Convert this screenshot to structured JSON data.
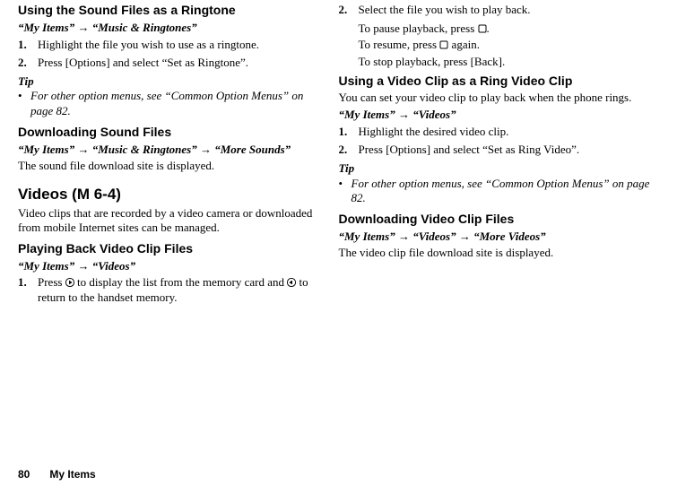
{
  "left": {
    "h1": "Using the Sound Files as a Ringtone",
    "path1_a": "“My Items”",
    "arrow": "→",
    "path1_b": "“Music & Ringtones”",
    "step1_marker": "1.",
    "step1_text": "Highlight the file you wish to use as a ringtone.",
    "step2_marker": "2.",
    "step2_text": "Press [Options] and select “Set as Ringtone”.",
    "tip_label": "Tip",
    "tip_bullet": "•",
    "tip_text": "For other option menus, see “Common Option Menus” on page 82.",
    "h2": "Downloading Sound Files",
    "path2_a": "“My Items”",
    "path2_b": "“Music & Ringtones”",
    "path2_c": "“More Sounds”",
    "dl_text": "The sound file download site is displayed.",
    "h_major": "Videos (M 6-4)",
    "videos_intro": "Video clips that are recorded by a video camera or downloaded from mobile Internet sites can be managed.",
    "h3": "Playing Back Video Clip Files",
    "path3_a": "“My Items”",
    "path3_b": "“Videos”",
    "play_step1_marker": "1.",
    "play_step1_a": "Press ",
    "play_step1_b": " to display the list from the memory card and ",
    "play_step1_c": " to return to the handset memory."
  },
  "right": {
    "step2_marker": "2.",
    "step2_text": "Select the file you wish to play back.",
    "pause_a": "To pause playback, press ",
    "pause_b": ".",
    "resume_a": "To resume, press ",
    "resume_b": " again.",
    "stop_text": "To stop playback, press [Back].",
    "h1": "Using a Video Clip as a Ring Video Clip",
    "intro": "You can set your video clip to play back when the phone rings.",
    "path1_a": "“My Items”",
    "arrow": "→",
    "path1_b": "“Videos”",
    "rstep1_marker": "1.",
    "rstep1_text": "Highlight the desired video clip.",
    "rstep2_marker": "2.",
    "rstep2_text": "Press [Options] and select “Set as Ring Video”.",
    "tip_label": "Tip",
    "tip_bullet": "•",
    "tip_text": "For other option menus, see “Common Option Menus” on page 82.",
    "h2": "Downloading Video Clip Files",
    "path2_a": "“My Items”",
    "path2_b": "“Videos”",
    "path2_c": "“More Videos”",
    "dl_text": "The video clip file download site is displayed."
  },
  "footer": {
    "page": "80",
    "section": "My Items"
  }
}
